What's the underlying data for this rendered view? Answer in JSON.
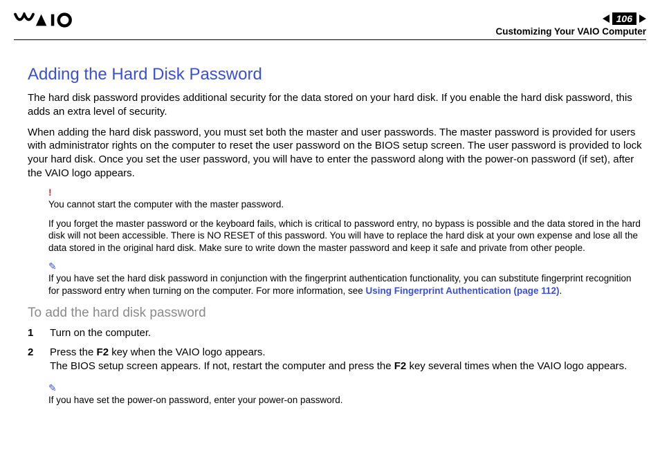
{
  "header": {
    "page_number": "106",
    "breadcrumb": "Customizing Your VAIO Computer"
  },
  "content": {
    "title": "Adding the Hard Disk Password",
    "para1": "The hard disk password provides additional security for the data stored on your hard disk. If you enable the hard disk password, this adds an extra level of security.",
    "para2": "When adding the hard disk password, you must set both the master and user passwords. The master password is provided for users with administrator rights on the computer to reset the user password on the BIOS setup screen. The user password is provided to lock your hard disk. Once you set the user password, you will have to enter the password along with the power-on password (if set), after the VAIO logo appears.",
    "warning1": "You cannot start the computer with the master password.",
    "warning2": "If you forget the master password or the keyboard fails, which is critical to password entry, no bypass is possible and the data stored in the hard disk will not been accessible. There is NO RESET of this password. You will have to replace the hard disk at your own expense and lose all the data stored in the original hard disk. Make sure to write down the master password and keep it safe and private from other people.",
    "note1_pre": "If you have set the hard disk password in conjunction with the fingerprint authentication functionality, you can substitute fingerprint recognition for password entry when turning on the computer. For more information, see ",
    "note1_link": "Using Fingerprint Authentication (page 112)",
    "note1_post": ".",
    "subtitle": "To add the hard disk password",
    "steps": {
      "s1": {
        "n": "1",
        "text": "Turn on the computer."
      },
      "s2": {
        "n": "2",
        "line1_a": "Press the ",
        "line1_b": "F2",
        "line1_c": " key when the VAIO logo appears.",
        "line2_a": "The BIOS setup screen appears. If not, restart the computer and press the ",
        "line2_b": "F2",
        "line2_c": " key several times when the VAIO logo appears."
      }
    },
    "note2": "If you have set the power-on password, enter your power-on password."
  }
}
